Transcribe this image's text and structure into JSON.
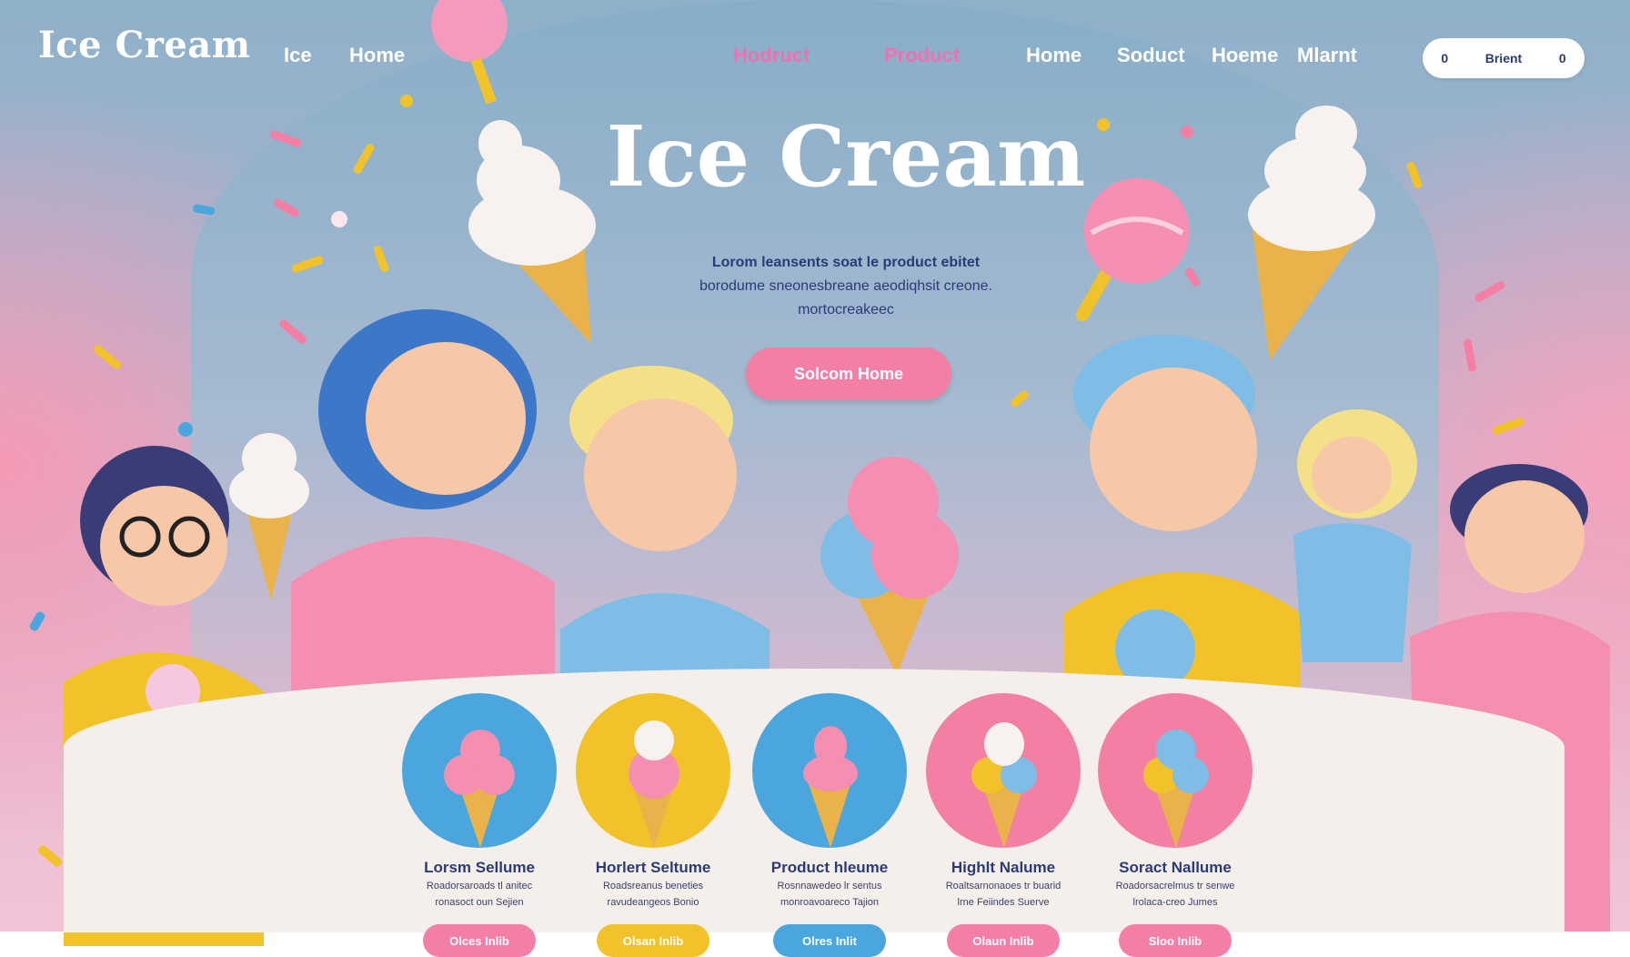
{
  "header": {
    "logo": "Ice Cream",
    "nav": [
      {
        "label": "Ice",
        "style": "white"
      },
      {
        "label": "Home",
        "style": "white"
      },
      {
        "label": "Hodruct",
        "style": "pink"
      },
      {
        "label": "Product",
        "style": "pink"
      },
      {
        "label": "Home",
        "style": "white"
      },
      {
        "label": "Soduct",
        "style": "white"
      },
      {
        "label": "Hoeme",
        "style": "white"
      },
      {
        "label": "Mlarnt",
        "style": "white"
      }
    ],
    "search": {
      "left": "0",
      "label": "Brient",
      "right": "0"
    }
  },
  "hero": {
    "title": "Ice Cream",
    "desc_line1": "Lorom leansents soat le product ebitet",
    "desc_line2": "borodume sneonesbreane aeodiqhsit creone.",
    "desc_line3": "mortocreakeec",
    "cta": "Solcom Home"
  },
  "products": [
    {
      "name": "Lorsm Sellume",
      "desc1": "Roadorsaroads tl anitec",
      "desc2": "ronasoct oun Sejien",
      "button": "Olces Inlib",
      "circle": "#4aa6dc",
      "btn": "#f47fa5"
    },
    {
      "name": "Horlert Seltume",
      "desc1": "Roadsreanus beneties",
      "desc2": "ravudeangeos Bonio",
      "button": "Olsan Inlib",
      "circle": "#f2c22a",
      "btn": "#f2c22a"
    },
    {
      "name": "Product hleume",
      "desc1": "Rosnnawedeo lr sentus",
      "desc2": "monroavoareco Tajion",
      "button": "Olres Inlit",
      "circle": "#4aa6dc",
      "btn": "#4aa6dc"
    },
    {
      "name": "Highlt Nalume",
      "desc1": "Roaltsarnonaoes tr buarid",
      "desc2": "lrne Feiindes Suerve",
      "button": "Olaun Inlib",
      "circle": "#f47fa5",
      "btn": "#f47fa5"
    },
    {
      "name": "Soract Nallume",
      "desc1": "Roadorsacrelmus tr senwe",
      "desc2": "lrolaca-creo Jumes",
      "button": "Sloo Inlib",
      "circle": "#f47fa5",
      "btn": "#f47fa5"
    }
  ],
  "colors": {
    "accent_pink": "#f47fa5",
    "accent_yellow": "#f2c22a",
    "accent_blue": "#4aa6dc",
    "text_navy": "#2b3a78"
  }
}
